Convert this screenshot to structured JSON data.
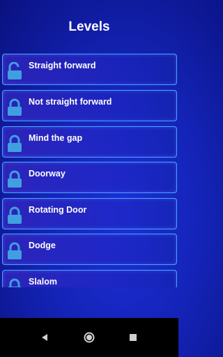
{
  "header": {
    "title": "Levels"
  },
  "levels": [
    {
      "label": "Straight forward",
      "icon": "unlocked-padlock-icon"
    },
    {
      "label": "Not straight forward",
      "icon": "locked-padlock-icon"
    },
    {
      "label": "Mind the gap",
      "icon": "locked-padlock-icon"
    },
    {
      "label": "Doorway",
      "icon": "locked-padlock-icon"
    },
    {
      "label": "Rotating Door",
      "icon": "locked-padlock-icon"
    },
    {
      "label": "Dodge",
      "icon": "locked-padlock-icon"
    },
    {
      "label": "Slalom",
      "icon": "locked-padlock-icon"
    }
  ],
  "colors": {
    "accent": "#4aa3ff",
    "lock": "#3f9fe0",
    "background": "#1424b8"
  },
  "navbar": {
    "icons": [
      "back-triangle-icon",
      "home-circle-icon",
      "recents-square-icon"
    ]
  }
}
